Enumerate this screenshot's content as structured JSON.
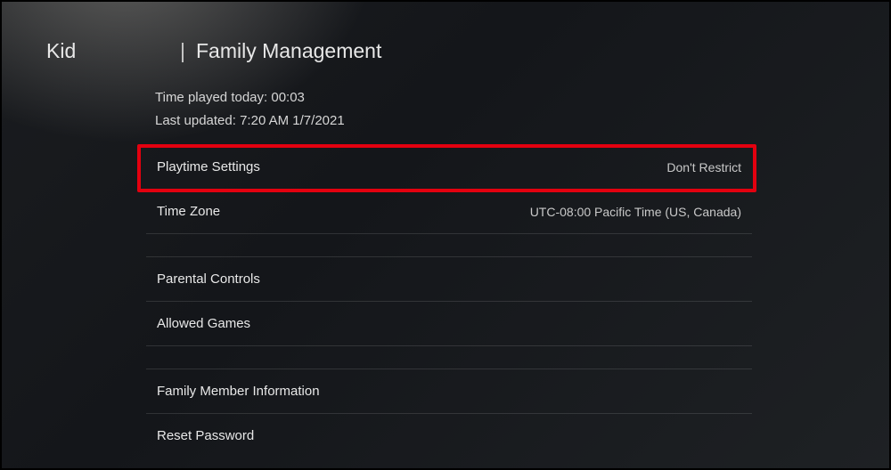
{
  "header": {
    "user": "Kid",
    "title": "Family Management"
  },
  "info": {
    "time_played_label": "Time played today:",
    "time_played_value": "00:03",
    "last_updated_label": "Last updated:",
    "last_updated_value": "7:20 AM 1/7/2021"
  },
  "rows": {
    "playtime": {
      "label": "Playtime Settings",
      "value": "Don't Restrict"
    },
    "timezone": {
      "label": "Time Zone",
      "value": "UTC-08:00 Pacific Time (US, Canada)"
    },
    "parental": {
      "label": "Parental Controls"
    },
    "allowed": {
      "label": "Allowed Games"
    },
    "member": {
      "label": "Family Member Information"
    },
    "reset": {
      "label": "Reset Password"
    }
  }
}
